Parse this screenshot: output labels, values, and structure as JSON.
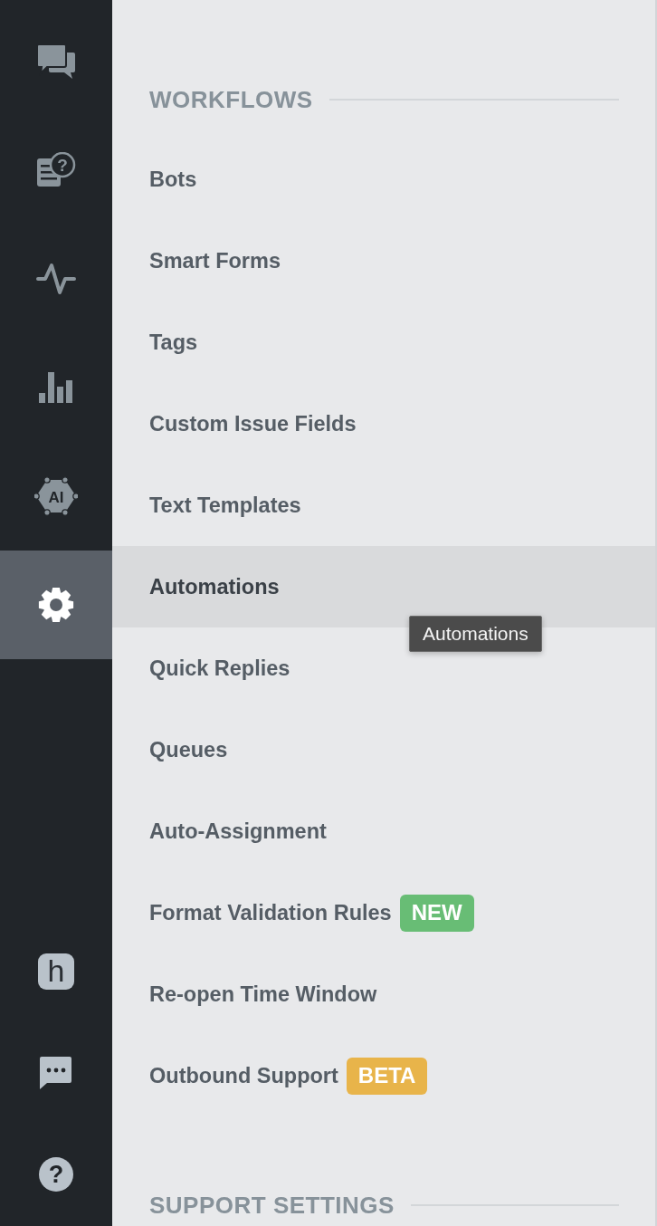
{
  "rail": {
    "items": [
      {
        "kind": "chat",
        "selected": false
      },
      {
        "kind": "faq",
        "glyph": "?",
        "selected": false
      },
      {
        "kind": "pulse",
        "selected": false
      },
      {
        "kind": "chart",
        "selected": false
      },
      {
        "kind": "ai",
        "text": "AI",
        "selected": false
      },
      {
        "kind": "settings",
        "selected": true
      }
    ],
    "bottom_items": [
      {
        "kind": "logo",
        "text": "h"
      },
      {
        "kind": "feedback"
      },
      {
        "kind": "help",
        "glyph": "?"
      }
    ]
  },
  "sections": [
    {
      "title": "WORKFLOWS",
      "items": [
        {
          "label": "Bots",
          "selected": false
        },
        {
          "label": "Smart Forms",
          "selected": false
        },
        {
          "label": "Tags",
          "selected": false
        },
        {
          "label": "Custom Issue Fields",
          "selected": false
        },
        {
          "label": "Text Templates",
          "selected": false
        },
        {
          "label": "Automations",
          "selected": true,
          "tooltip": "Automations"
        },
        {
          "label": "Quick Replies",
          "selected": false
        },
        {
          "label": "Queues",
          "selected": false
        },
        {
          "label": "Auto-Assignment",
          "selected": false
        },
        {
          "label": "Format Validation Rules",
          "selected": false,
          "badge": {
            "text": "NEW",
            "color": "#68bd75"
          }
        },
        {
          "label": "Re-open Time Window",
          "selected": false
        },
        {
          "label": "Outbound Support",
          "selected": false,
          "badge": {
            "text": "BETA",
            "color": "#e8b44a"
          }
        }
      ]
    },
    {
      "title": "SUPPORT SETTINGS"
    }
  ]
}
